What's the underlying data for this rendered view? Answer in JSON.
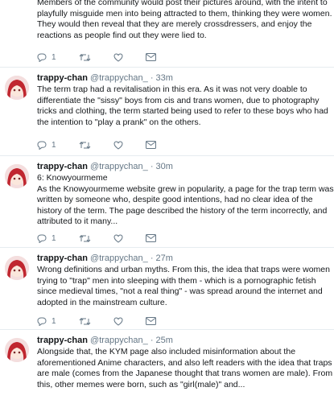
{
  "tweets": [
    {
      "show_header": false,
      "lines": [
        "Members of the community would post their pictures around, with the intent to",
        "playfully misguide men into being attracted to them, thinking they were women.",
        "They would then reveal that they are merely crossdressers, and enjoy the",
        "reactions as people find out they were lied to."
      ],
      "reply_count": "1"
    },
    {
      "show_header": true,
      "name": "trappy-chan",
      "handle": "@trappychan_",
      "time": "· 33m",
      "lines": [
        "The term trap had a revitalisation in this era. As it was not very doable to",
        "differentiate the \"sissy\" boys from cis and trans women, due to photography",
        "tricks and clothing, the term started being used to refer to these boys who had",
        "the intention to \"play a prank\" on the others."
      ],
      "reply_count": "1"
    },
    {
      "show_header": true,
      "name": "trappy-chan",
      "handle": "@trappychan_",
      "time": "· 30m",
      "lines": [
        "6: Knowyourmeme",
        "As the Knowyourmeme website grew in popularity, a page for the trap term was",
        "written by someone who, despite good intentions, had no clear idea of the",
        "history of the term. The page described the history of the term incorrectly, and",
        "attributed to it many..."
      ],
      "reply_count": "1"
    },
    {
      "show_header": true,
      "name": "trappy-chan",
      "handle": "@trappychan_",
      "time": "· 27m",
      "lines": [
        "Wrong definitions and urban myths. From this, the idea that traps were women",
        "trying to \"trap\" men into sleeping with them - which is a pornographic fetish",
        "since medieval times, \"not a real thing\" - was spread around the internet and",
        "adopted in the mainstream culture."
      ],
      "reply_count": "1"
    },
    {
      "show_header": true,
      "name": "trappy-chan",
      "handle": "@trappychan_",
      "time": "· 25m",
      "lines": [
        "Alongside that, the KYM page also included misinformation about the",
        "aforementioned Anime characters, and also left readers with the idea that traps",
        "are male (comes from the Japanese thought that trans women are male). From",
        "this, other memes were born, such as \"girl(male)\" and..."
      ],
      "reply_count": ""
    }
  ],
  "colors": {
    "text": "#14171a",
    "meta": "#657786",
    "divider": "#e6ecf0",
    "avatar_hair": "#c0262f"
  },
  "icons": [
    "reply-icon",
    "retweet-icon",
    "like-icon",
    "message-icon"
  ]
}
